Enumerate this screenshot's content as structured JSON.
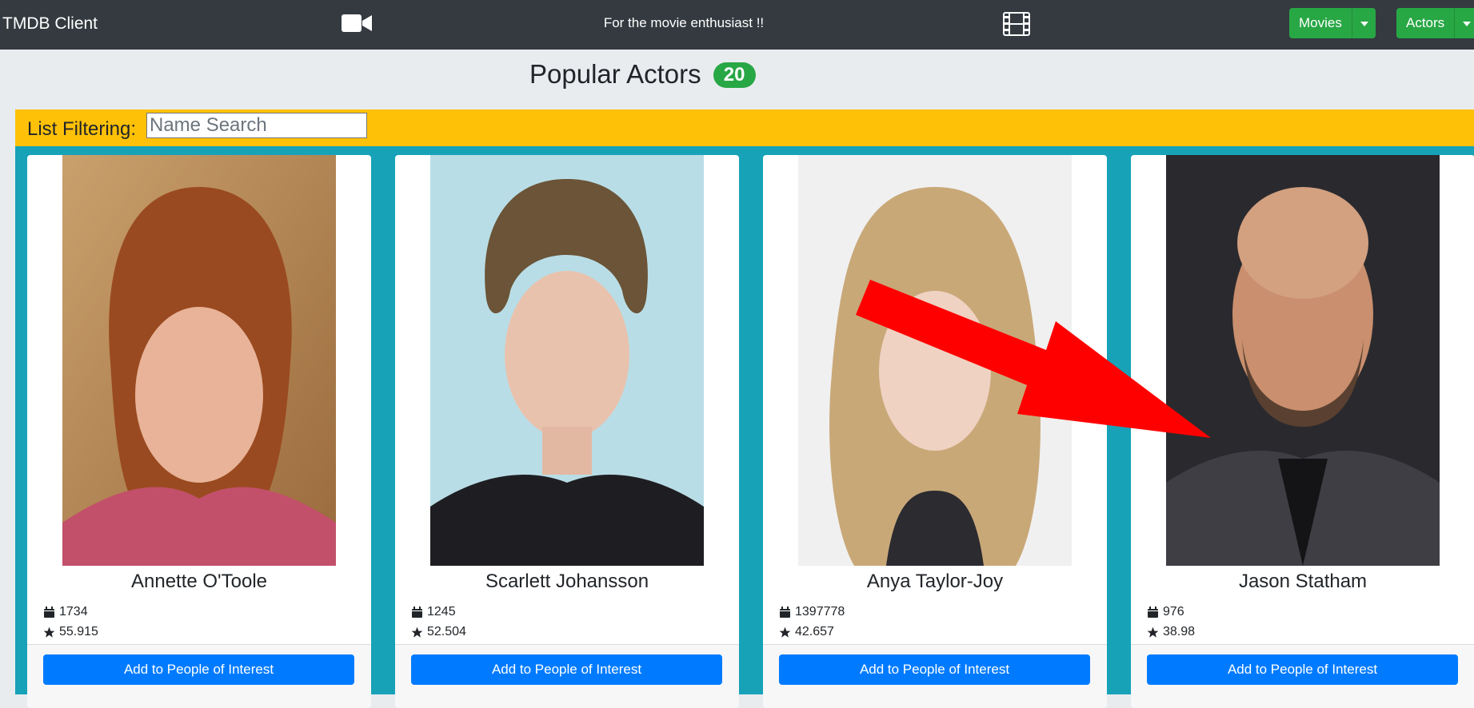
{
  "navbar": {
    "brand": "TMDB Client",
    "tagline": "For the movie enthusiast !!",
    "left_icon": "video-camera-icon",
    "right_icon": "film-icon",
    "movies_label": "Movies",
    "actors_label": "Actors"
  },
  "header": {
    "title": "Popular Actors",
    "count": "20"
  },
  "filter": {
    "label": "List Filtering:",
    "placeholder": "Name Search",
    "value": ""
  },
  "actors": [
    {
      "name": "Annette O'Toole",
      "id": "1734",
      "popularity": "55.915",
      "button": "Add to People of Interest"
    },
    {
      "name": "Scarlett Johansson",
      "id": "1245",
      "popularity": "52.504",
      "button": "Add to People of Interest"
    },
    {
      "name": "Anya Taylor-Joy",
      "id": "1397778",
      "popularity": "42.657",
      "button": "Add to People of Interest"
    },
    {
      "name": "Jason Statham",
      "id": "976",
      "popularity": "38.98",
      "button": "Add to People of Interest"
    }
  ],
  "colors": {
    "navbar": "#343a40",
    "filter_bar": "#ffc107",
    "cards_background": "#17a2b8",
    "primary_button": "#007bff",
    "success": "#28a745",
    "annotation_arrow": "#ff0000"
  }
}
